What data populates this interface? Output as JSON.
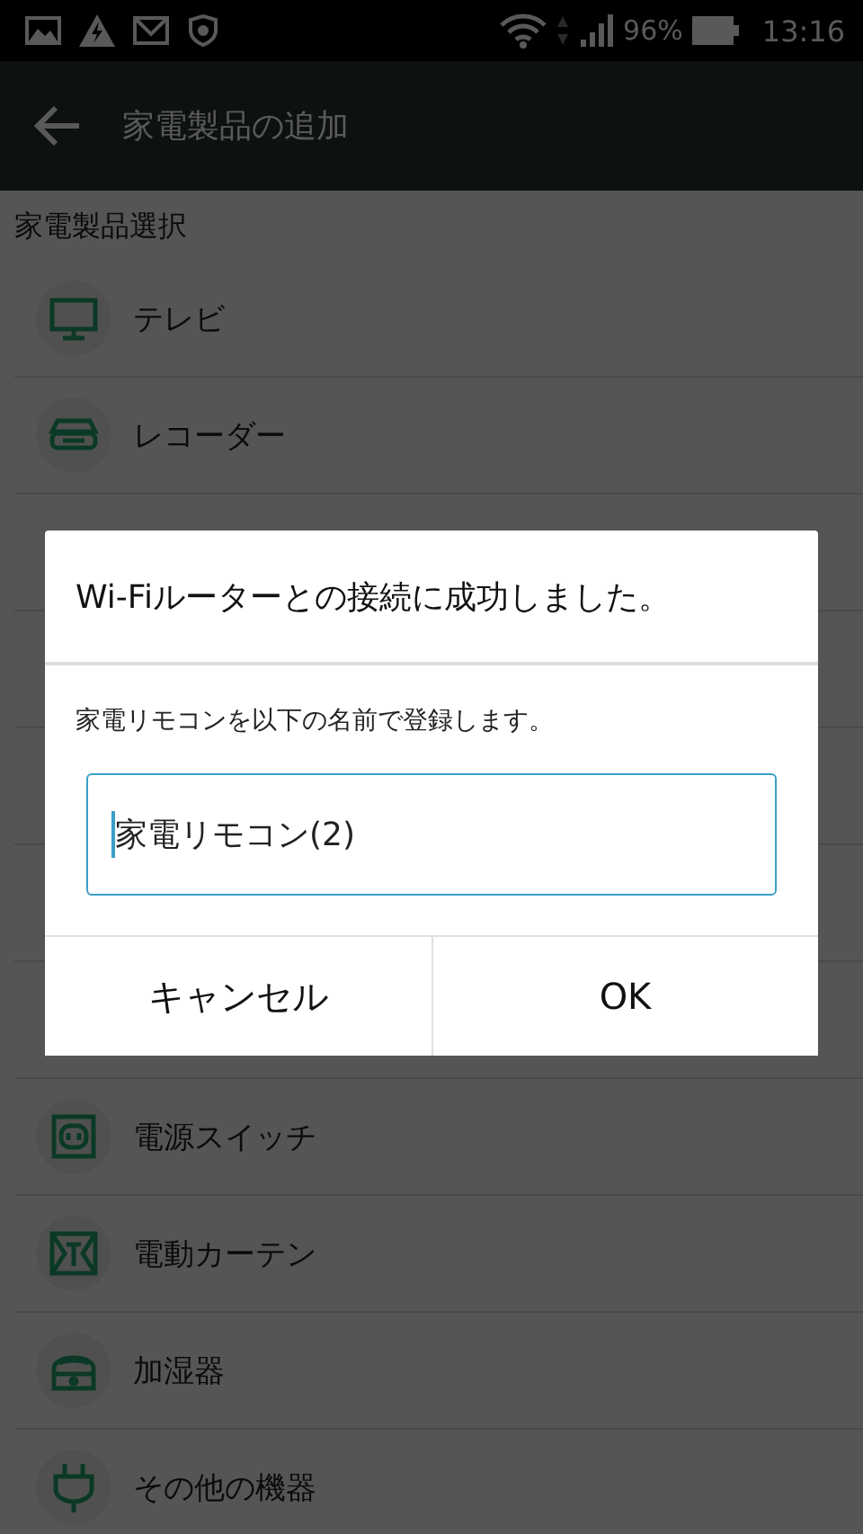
{
  "status_bar": {
    "battery": "96%",
    "time": "13:16"
  },
  "app_bar": {
    "title": "家電製品の追加"
  },
  "section": {
    "title": "家電製品選択"
  },
  "devices": [
    {
      "kind": "tv",
      "label": "テレビ"
    },
    {
      "kind": "recorder",
      "label": "レコーダー"
    },
    {
      "kind": "covered"
    },
    {
      "kind": "covered"
    },
    {
      "kind": "covered"
    },
    {
      "kind": "covered"
    },
    {
      "kind": "covered"
    },
    {
      "kind": "outlet",
      "label": "電源スイッチ"
    },
    {
      "kind": "curtain",
      "label": "電動カーテン"
    },
    {
      "kind": "humidifier",
      "label": "加湿器"
    },
    {
      "kind": "plug",
      "label": "その他の機器"
    }
  ],
  "dialog": {
    "title": "Wi-Fiルーターとの接続に成功しました。",
    "message": "家電リモコンを以下の名前で登録します。",
    "name_field": {
      "value": "家電リモコン(2)"
    },
    "buttons": [
      "キャンセル",
      "OK"
    ]
  }
}
